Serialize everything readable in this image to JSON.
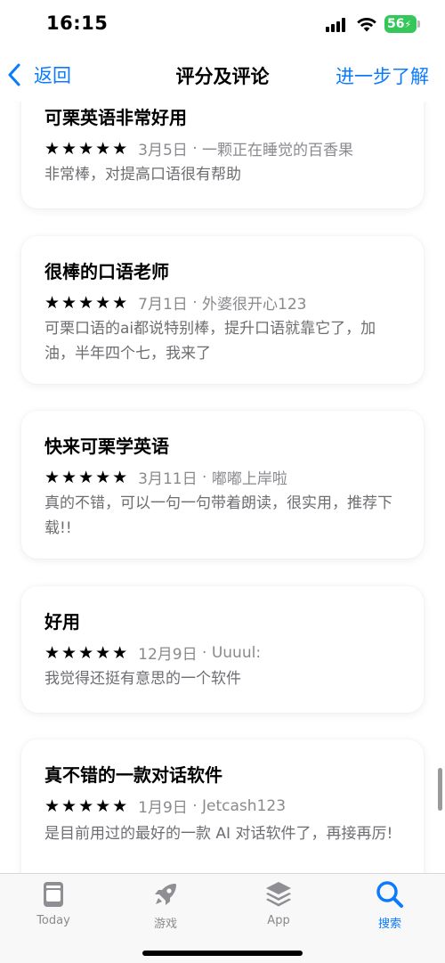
{
  "status": {
    "time": "16:15",
    "battery": "56"
  },
  "nav": {
    "back_label": "返回",
    "title": "评分及评论",
    "learn_more": "进一步了解"
  },
  "reviews": [
    {
      "title": "可栗英语非常好用",
      "stars": "★★★★★",
      "date": "3月5日",
      "author": "一颗正在睡觉的百香果",
      "body": "非常棒，对提高口语很有帮助"
    },
    {
      "title": "很棒的口语老师",
      "stars": "★★★★★",
      "date": "7月1日",
      "author": "外婆很开心123",
      "body": "可栗口语的ai都说特别棒，提升口语就靠它了，加油，半年四个七，我来了"
    },
    {
      "title": "快来可栗学英语",
      "stars": "★★★★★",
      "date": "3月11日",
      "author": "嘟嘟上岸啦",
      "body": "真的不错，可以一句一句带着朗读，很实用，推荐下载!!"
    },
    {
      "title": "好用",
      "stars": "★★★★★",
      "date": "12月9日",
      "author": "Uuuul:",
      "body": "我觉得还挺有意思的一个软件"
    },
    {
      "title": "真不错的一款对话软件",
      "stars": "★★★★★",
      "date": "1月9日",
      "author": "Jetcash123",
      "body": "是目前用过的最好的一款 AI 对话软件了，再接再厉!"
    }
  ],
  "tabs": [
    {
      "label": "Today",
      "icon": "today-icon",
      "active": false
    },
    {
      "label": "游戏",
      "icon": "rocket-icon",
      "active": false
    },
    {
      "label": "App",
      "icon": "layers-icon",
      "active": false
    },
    {
      "label": "搜索",
      "icon": "search-icon",
      "active": true
    }
  ],
  "colors": {
    "accent": "#0a7aff",
    "battery": "#34c759",
    "secondary_text": "#8a8a8e"
  }
}
